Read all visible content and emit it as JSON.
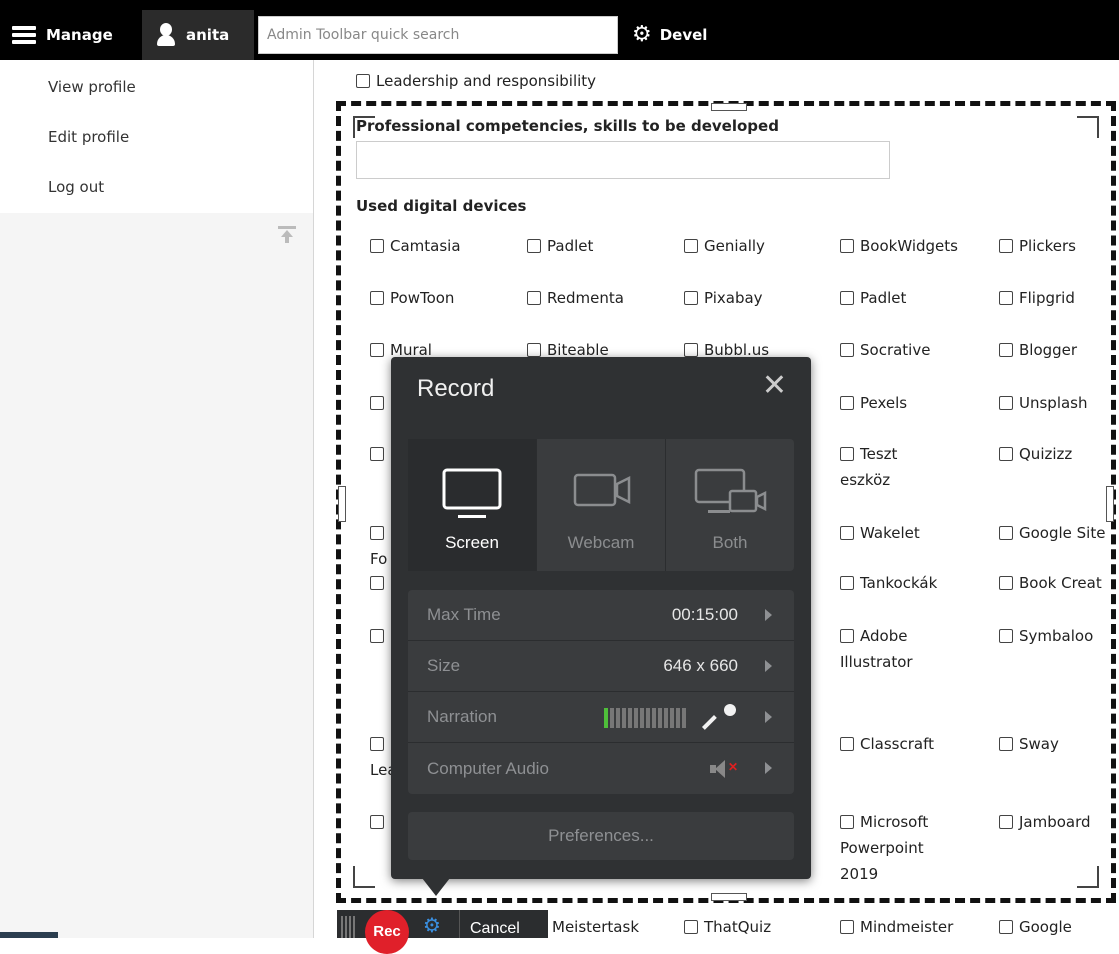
{
  "toolbar": {
    "manage_label": "Manage",
    "user_label": "anita",
    "search_placeholder": "Admin Toolbar quick search",
    "devel_label": "Devel"
  },
  "tray": {
    "items": [
      {
        "label": "View profile"
      },
      {
        "label": "Edit profile"
      },
      {
        "label": "Log out"
      }
    ]
  },
  "form": {
    "leadership_label": "Leadership and responsibility",
    "competencies_label": "Professional competencies, skills to be developed",
    "competencies_value": "",
    "devices_title": "Used digital devices",
    "devices": [
      {
        "label": "Camtasia"
      },
      {
        "label": "Padlet"
      },
      {
        "label": "Genially"
      },
      {
        "label": "BookWidgets"
      },
      {
        "label": "Plickers"
      },
      {
        "label": "PowToon"
      },
      {
        "label": "Redmenta"
      },
      {
        "label": "Pixabay"
      },
      {
        "label": "Padlet"
      },
      {
        "label": "Flipgrid"
      },
      {
        "label": "Mural"
      },
      {
        "label": "Biteable"
      },
      {
        "label": "Bubbl.us"
      },
      {
        "label": "Socrative"
      },
      {
        "label": "Blogger"
      },
      {
        "label": "Pexels"
      },
      {
        "label": "Unsplash"
      },
      {
        "label": "Teszt eszköz"
      },
      {
        "label": "Quizizz"
      },
      {
        "label": "Fo"
      },
      {
        "label": "Wakelet"
      },
      {
        "label": "Google Site"
      },
      {
        "label": "Tankockák"
      },
      {
        "label": "Book Creat"
      },
      {
        "label": "Adobe Illustrator"
      },
      {
        "label": "Symbaloo"
      },
      {
        "label": "Lea"
      },
      {
        "label": "Classcraft"
      },
      {
        "label": "Sway"
      },
      {
        "label": "Microsoft Powerpoint 2019"
      },
      {
        "label": "Jamboard"
      },
      {
        "label": "Meistertask"
      },
      {
        "label": "ThatQuiz"
      },
      {
        "label": "Mindmeister"
      },
      {
        "label": "Google"
      }
    ]
  },
  "recorder": {
    "title": "Record",
    "modes": [
      {
        "label": "Screen",
        "icon": "monitor-icon"
      },
      {
        "label": "Webcam",
        "icon": "webcam-icon"
      },
      {
        "label": "Both",
        "icon": "screen-webcam-icon"
      }
    ],
    "settings": {
      "max_time_label": "Max Time",
      "max_time_value": "00:15:00",
      "size_label": "Size",
      "size_value": "646 x 660",
      "narration_label": "Narration",
      "narration_level": 0.1,
      "computer_audio_label": "Computer Audio"
    },
    "preferences_label": "Preferences...",
    "rec_button": "Rec",
    "cancel_button": "Cancel",
    "colors": {
      "panel": "#2f3133",
      "rec": "#e0202a",
      "level": "#4fbf3a",
      "gear": "#3a8fe0"
    }
  }
}
